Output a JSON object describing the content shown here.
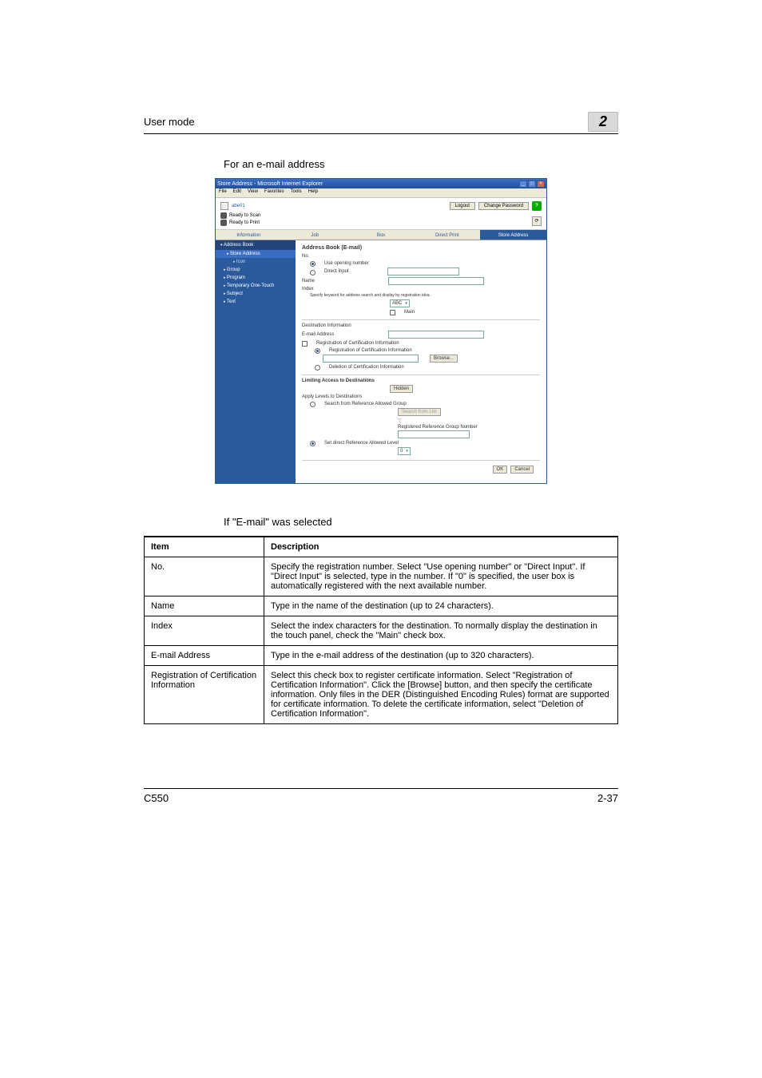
{
  "header": {
    "title": "User mode",
    "chip": "2"
  },
  "sectionTitle": "For an e-mail address",
  "window": {
    "title": "Store Address - Microsoft Internet Explorer",
    "menu": [
      "File",
      "Edit",
      "View",
      "Favorites",
      "Tools",
      "Help"
    ],
    "user": "abe01",
    "logout": "Logout",
    "changepw": "Change Password",
    "readyScan": "Ready to Scan",
    "readyPrint": "Ready to Print",
    "tabs": [
      "Information",
      "Job",
      "Box",
      "Direct Print",
      "Store Address"
    ],
    "sidebar": {
      "top": "Address Book",
      "sub": "Store Address",
      "subsub": "Icon",
      "items": [
        "Group",
        "Program",
        "Temporary One-Touch",
        "Subject",
        "Text"
      ]
    },
    "panel": {
      "heading": "Address Book (E-mail)",
      "noLabel": "No.",
      "useOpening": "Use opening number",
      "directInput": "Direct Input",
      "nameLabel": "Name",
      "indexLabel": "Index",
      "indexNote": "Specify keyword for address search and display by registration idea.",
      "indexSelect": "ABC",
      "mainChk": "Main",
      "destHeading": "Destination Information",
      "emailLabel": "E-mail Address",
      "regCertChk": "Registration of Certification Information",
      "regCertRadio": "Registration of Certification Information",
      "browse": "Browse...",
      "delCertRadio": "Deletion of Certification Information",
      "limitHeading": "Limiting Access to Destinations",
      "hidden": "Hidden",
      "applyLevels": "Apply Levels to Destinations",
      "searchGroup": "Search from Reference Allowed Group",
      "searchList": "Search from List",
      "regGroupNum": "Registered Reference Group Number",
      "setDirect": "Set direct Reference Allowed Level",
      "levelVal": "0",
      "ok": "OK",
      "cancel": "Cancel"
    }
  },
  "subsection": "If \"E-mail\" was selected",
  "tableHead": {
    "item": "Item",
    "desc": "Description"
  },
  "rows": [
    {
      "item": "No.",
      "desc": "Specify the registration number.\nSelect \"Use opening number\" or \"Direct Input\". If \"Direct Input\" is selected, type in the number. If \"0\" is specified, the user box is automatically registered with the next available number."
    },
    {
      "item": "Name",
      "desc": "Type in the name of the destination (up to 24 characters)."
    },
    {
      "item": "Index",
      "desc": "Select the index characters for the destination. To normally display the destination in the touch panel, check the \"Main\" check box."
    },
    {
      "item": "E-mail Address",
      "desc": "Type in the e-mail address of the destination (up to 320 characters)."
    },
    {
      "item": "Registration of Certification Information",
      "desc": "Select this check box to register certificate information.\nSelect \"Registration of Certification Information\". Click the [Browse] button, and then specify the certificate information. Only files in the DER (Distinguished Encoding Rules) format are supported for certificate information.\nTo delete the certificate information, select \"Deletion of Certification Information\"."
    }
  ],
  "footer": {
    "left": "C550",
    "right": "2-37"
  }
}
